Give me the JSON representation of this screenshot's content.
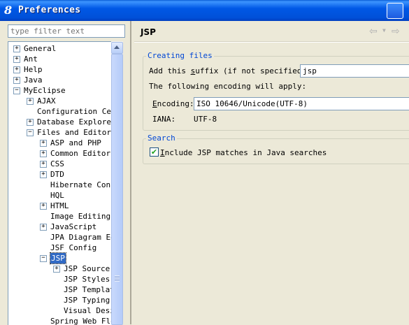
{
  "window": {
    "title": "Preferences"
  },
  "filter": {
    "placeholder": "type filter text"
  },
  "tree": [
    {
      "label": "General",
      "expander": "+"
    },
    {
      "label": "Ant",
      "expander": "+"
    },
    {
      "label": "Help",
      "expander": "+"
    },
    {
      "label": "Java",
      "expander": "+"
    },
    {
      "label": "MyEclipse",
      "expander": "-"
    },
    {
      "label": "AJAX",
      "expander": "+"
    },
    {
      "label": "Configuration Cent",
      "expander": ""
    },
    {
      "label": "Database Explorer",
      "expander": "+"
    },
    {
      "label": "Files and Editors",
      "expander": "-"
    },
    {
      "label": "ASP and PHP",
      "expander": "+"
    },
    {
      "label": "Common Editor P",
      "expander": "+"
    },
    {
      "label": "CSS",
      "expander": "+"
    },
    {
      "label": "DTD",
      "expander": "+"
    },
    {
      "label": "Hibernate Confi",
      "expander": ""
    },
    {
      "label": "HQL",
      "expander": ""
    },
    {
      "label": "HTML",
      "expander": "+"
    },
    {
      "label": "Image Editing",
      "expander": ""
    },
    {
      "label": "JavaScript",
      "expander": "+"
    },
    {
      "label": "JPA Diagram Edi",
      "expander": ""
    },
    {
      "label": "JSF Config",
      "expander": ""
    },
    {
      "label": "JSP",
      "expander": "-",
      "selected": true
    },
    {
      "label": "JSP Source",
      "expander": "+"
    },
    {
      "label": "JSP Styles",
      "expander": ""
    },
    {
      "label": "JSP Templat",
      "expander": ""
    },
    {
      "label": "JSP Typing",
      "expander": ""
    },
    {
      "label": "Visual Desi",
      "expander": ""
    },
    {
      "label": "Spring Web Flow",
      "expander": ""
    }
  ],
  "page": {
    "title": "JSP",
    "creating_files": {
      "title": "Creating files",
      "suffix_label_pre": "Add this ",
      "suffix_label_key": "s",
      "suffix_label_post": "uffix (if not specified):",
      "suffix_value": "jsp",
      "encoding_note": "The following encoding will apply:",
      "encoding_label_key": "E",
      "encoding_label_post": "ncoding:",
      "encoding_value": "ISO 10646/Unicode(UTF-8)",
      "iana_label": "IANA:",
      "iana_value": "UTF-8"
    },
    "search": {
      "title": "Search",
      "checkbox_key": "I",
      "checkbox_label_post": "nclude JSP matches in Java searches",
      "checked": true
    }
  },
  "icons": {
    "app": "eclipse-8-icon",
    "back": "back-arrow-icon",
    "forward": "forward-arrow-icon",
    "check": "checkmark-icon"
  }
}
